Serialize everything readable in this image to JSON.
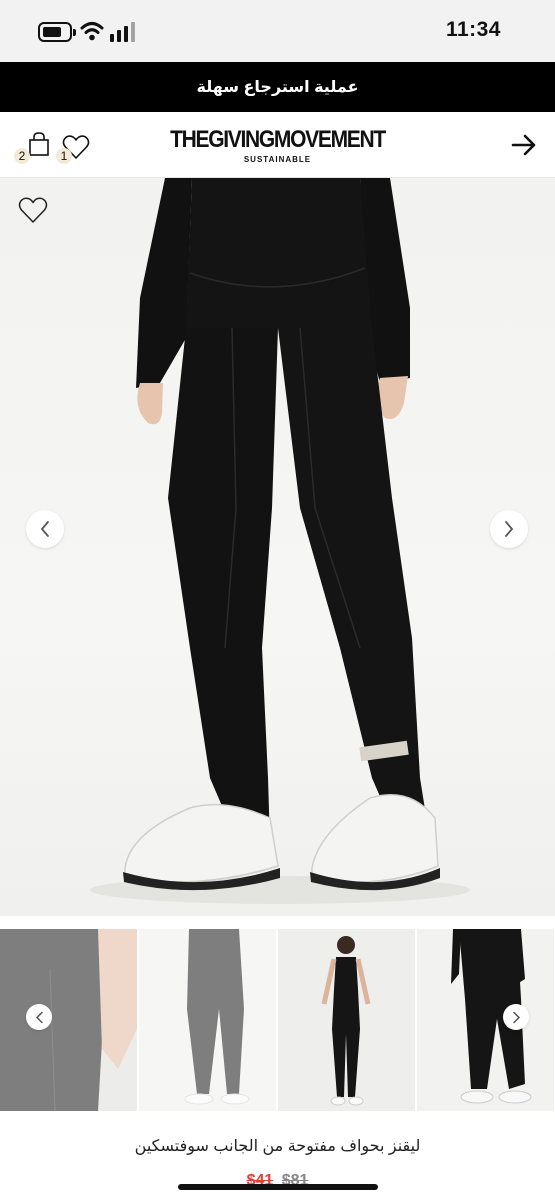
{
  "status_bar": {
    "time": "11:34",
    "battery_icon": "battery-icon",
    "wifi_icon": "wifi-icon",
    "signal_icon": "cellular-signal-icon"
  },
  "promo_banner": {
    "text": "عملية استرجاع سهلة"
  },
  "header": {
    "brand_name": "THEGIVINGMOVEMENT",
    "brand_tagline": "SUSTAINABLE",
    "cart_count": "2",
    "wishlist_count": "1",
    "cart_icon": "shopping-bag-icon",
    "wishlist_icon": "heart-icon",
    "back_icon": "arrow-right-icon"
  },
  "gallery": {
    "thumbnail_count": 4,
    "prev_icon": "chevron-left-icon",
    "next_icon": "chevron-right-icon",
    "wishlist_icon": "heart-outline-icon"
  },
  "product": {
    "title": "ليقنز بحواف مفتوحة من الجانب سوفتسكين",
    "sale_price": "$41",
    "original_price": "$81"
  },
  "colors": {
    "banner_bg": "#000000",
    "sale_price": "#e0403a",
    "badge_bg": "#f4ead8"
  }
}
